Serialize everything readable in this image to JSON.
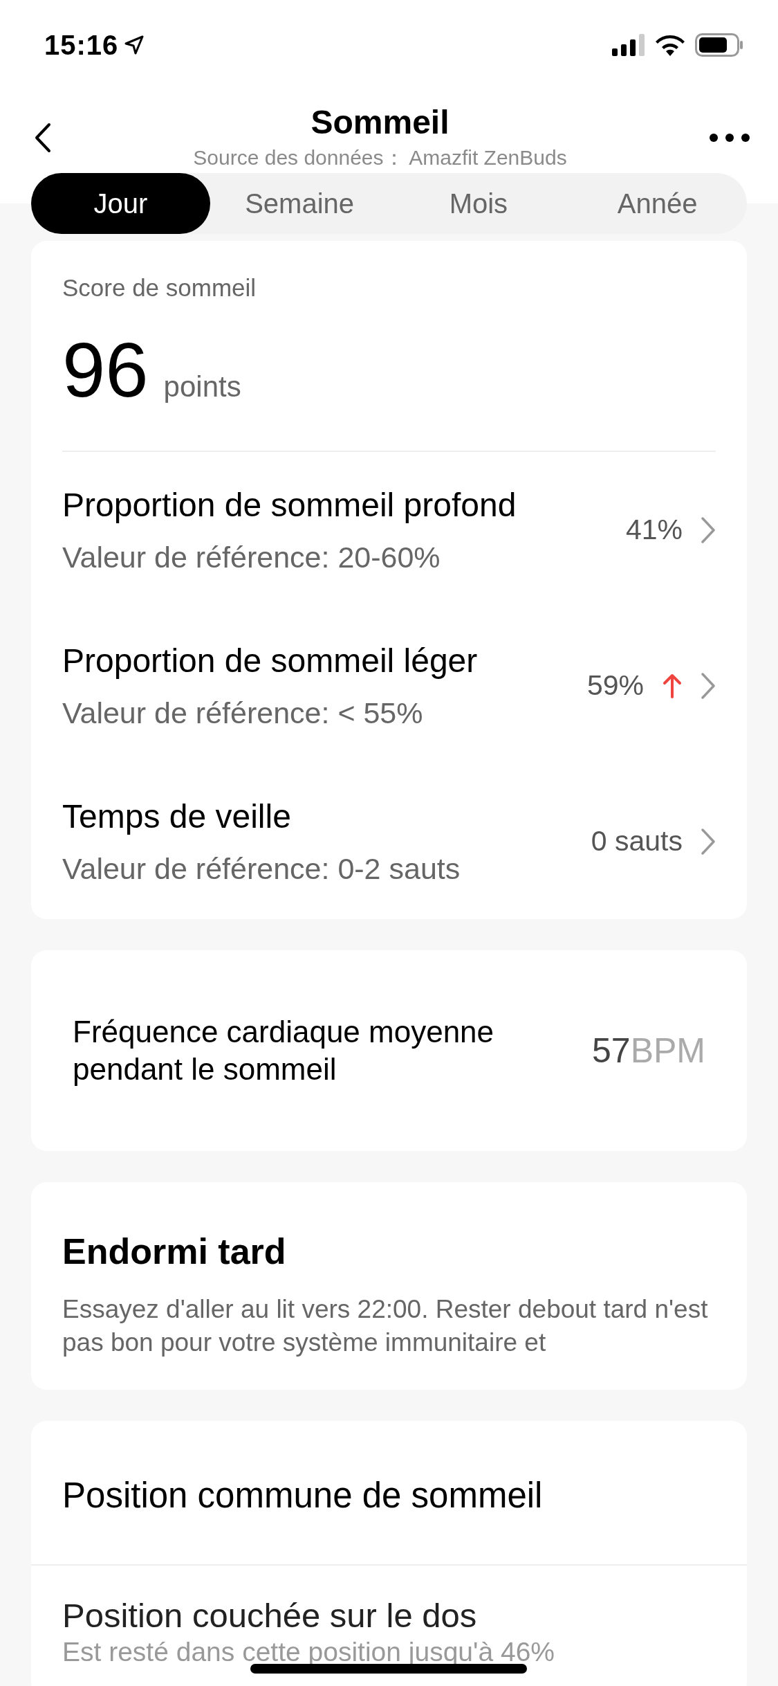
{
  "status_bar": {
    "time": "15:16"
  },
  "header": {
    "title": "Sommeil",
    "subtitle": "Source des données： Amazfit ZenBuds"
  },
  "tabs": [
    {
      "label": "Jour",
      "selected": true
    },
    {
      "label": "Semaine",
      "selected": false
    },
    {
      "label": "Mois",
      "selected": false
    },
    {
      "label": "Année",
      "selected": false
    }
  ],
  "score_card": {
    "label": "Score de sommeil",
    "value": "96",
    "unit": "points"
  },
  "metrics": [
    {
      "name": "Proportion de sommeil profond",
      "reference": "Valeur de référence: 20-60%",
      "value": "41%",
      "rising": false
    },
    {
      "name": "Proportion de sommeil léger",
      "reference": "Valeur de référence: < 55%",
      "value": "59%",
      "rising": true
    },
    {
      "name": "Temps de veille",
      "reference": "Valeur de référence: 0-2 sauts",
      "value": "0 sauts",
      "rising": false
    }
  ],
  "heart_rate": {
    "label": "Fréquence cardiaque moyenne pendant le sommeil",
    "value": "57",
    "unit": "BPM"
  },
  "advice": {
    "title": "Endormi tard",
    "text": "Essayez d'aller au lit vers 22:00. Rester debout tard n'est pas bon pour votre système immunitaire et"
  },
  "positions": {
    "title": "Position commune de sommeil",
    "items": [
      {
        "name": "Position couchée sur le dos",
        "detail": "Est resté dans cette position jusqu'à 46%"
      }
    ]
  }
}
